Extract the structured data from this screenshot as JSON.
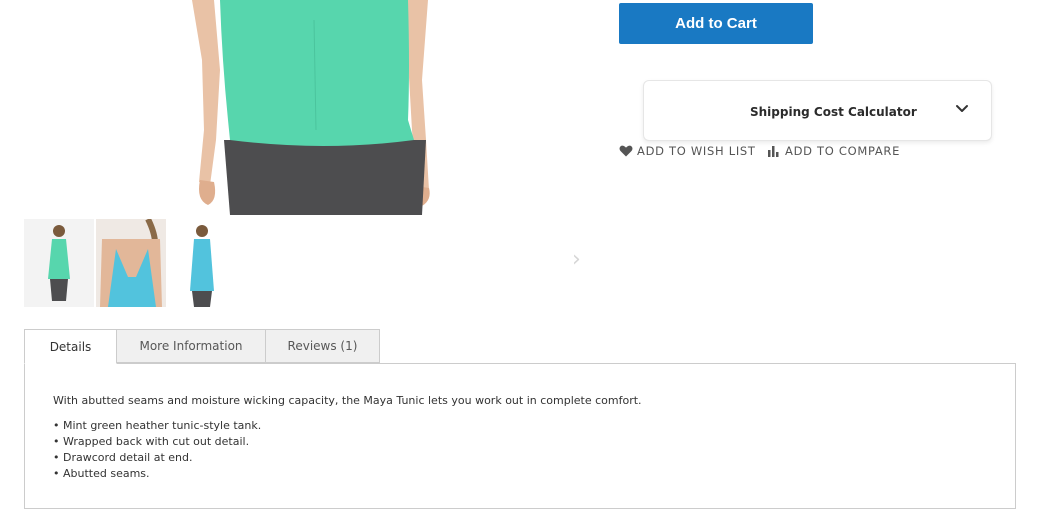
{
  "product": {
    "add_to_cart_label": "Add to Cart",
    "shipping_calculator_label": "Shipping Cost Calculator",
    "add_to_wishlist_label": "ADD TO WISH LIST",
    "add_to_compare_label": "ADD TO COMPARE",
    "icons": {
      "expand": "chevron-down-icon",
      "wishlist": "heart-icon",
      "compare": "bar-chart-icon",
      "thumbnail_next": "chevron-right-icon",
      "thumbnail_prev": "chevron-left-icon"
    },
    "colors": {
      "primary_button": "#1979c3",
      "active_thumbnail_border": "#e65a26",
      "product_mint": "#57d6ad",
      "product_blue": "#52c3dd"
    }
  },
  "tabs": [
    {
      "label": "Details",
      "active": true
    },
    {
      "label": "More Information",
      "active": false
    },
    {
      "label": "Reviews (1)",
      "active": false
    }
  ],
  "details": {
    "description": "With abutted seams and moisture wicking capacity, the Maya Tunic lets you work out in complete comfort.",
    "features": [
      "Mint green heather tunic-style tank.",
      "Wrapped back with cut out detail.",
      "Drawcord detail at end.",
      "Abutted seams."
    ]
  }
}
